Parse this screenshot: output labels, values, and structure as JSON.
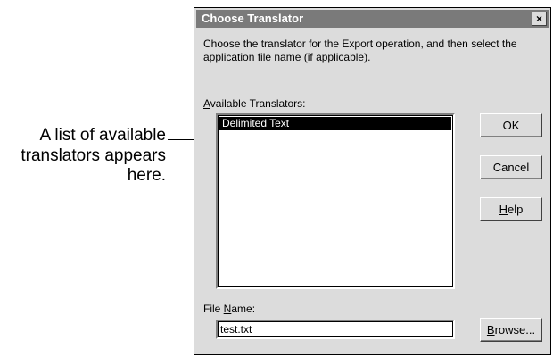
{
  "callout": {
    "line1": "A list of available",
    "line2": "translators appears",
    "line3": "here."
  },
  "dialog": {
    "title": "Choose Translator",
    "close_glyph": "×",
    "instructions": "Choose the translator for the Export operation, and then select the application file name (if applicable).",
    "translators_label_mnemonic": "A",
    "translators_label_rest": "vailable Translators:",
    "translators": [
      {
        "label": "Delimited Text",
        "selected": true
      }
    ],
    "filename_label_pre": "File ",
    "filename_label_mnemonic": "N",
    "filename_label_post": "ame:",
    "filename_value": "test.txt"
  },
  "buttons": {
    "ok": "OK",
    "cancel": "Cancel",
    "help_mnemonic": "H",
    "help_rest": "elp",
    "browse_mnemonic": "B",
    "browse_rest": "rowse..."
  },
  "colors": {
    "dialog_face": "#dcdcdc",
    "titlebar": "#7a7a7a",
    "selection": "#000000"
  },
  "icons": {
    "close": "close-icon"
  }
}
